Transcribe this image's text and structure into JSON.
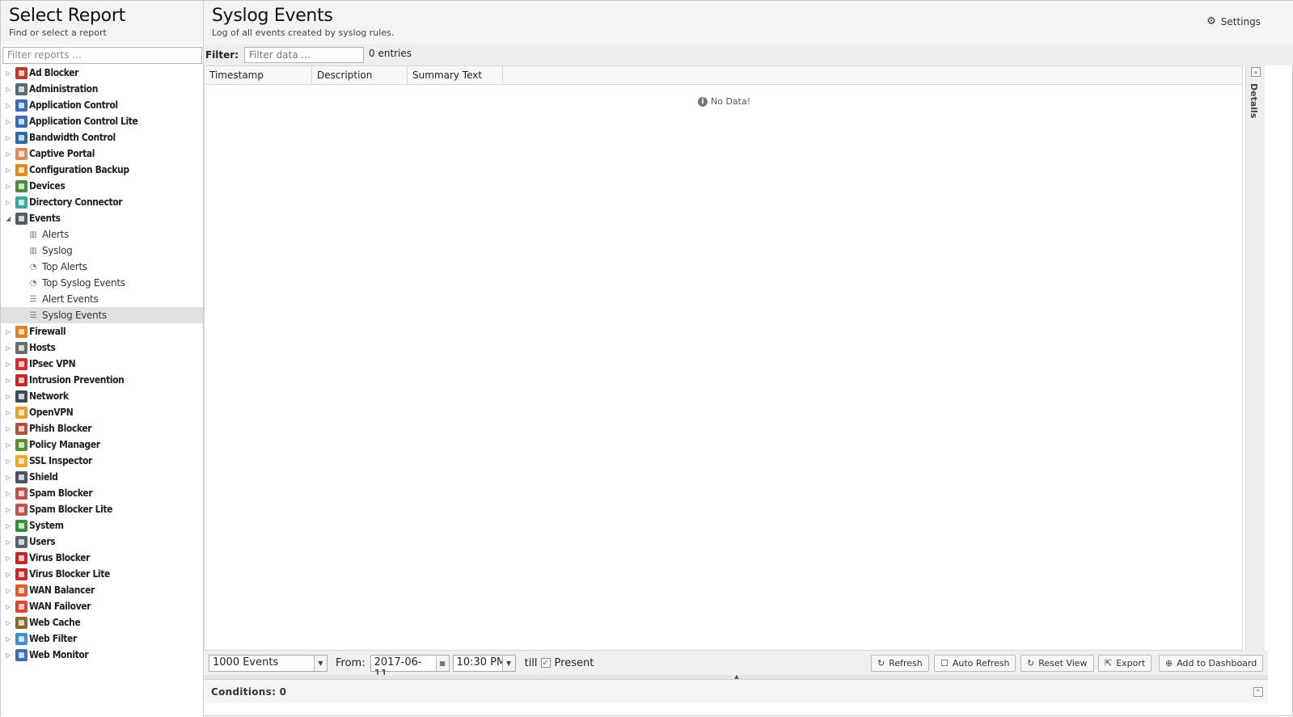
{
  "left": {
    "title": "Select Report",
    "subtitle": "Find or select a report",
    "filter_placeholder": "Filter reports ..."
  },
  "tree": [
    {
      "label": "Ad Blocker",
      "type": "parent",
      "icon": "ad-blocker-icon",
      "color": "#c0392b"
    },
    {
      "label": "Administration",
      "type": "parent",
      "icon": "administration-icon",
      "color": "#5a6b7a"
    },
    {
      "label": "Application Control",
      "type": "parent",
      "icon": "application-control-icon",
      "color": "#3b6db3"
    },
    {
      "label": "Application Control Lite",
      "type": "parent",
      "icon": "application-control-lite-icon",
      "color": "#3b6db3"
    },
    {
      "label": "Bandwidth Control",
      "type": "parent",
      "icon": "bandwidth-control-icon",
      "color": "#2e6da4"
    },
    {
      "label": "Captive Portal",
      "type": "parent",
      "icon": "captive-portal-icon",
      "color": "#d98c5f"
    },
    {
      "label": "Configuration Backup",
      "type": "parent",
      "icon": "configuration-backup-icon",
      "color": "#e08a1e"
    },
    {
      "label": "Devices",
      "type": "parent",
      "icon": "devices-icon",
      "color": "#4b8b3b"
    },
    {
      "label": "Directory Connector",
      "type": "parent",
      "icon": "directory-connector-icon",
      "color": "#3aa89b"
    },
    {
      "label": "Events",
      "type": "parent-open",
      "icon": "events-icon",
      "color": "#555e6a"
    },
    {
      "label": "Alerts",
      "type": "child",
      "icon": "bar-chart-icon",
      "glyph": "▥"
    },
    {
      "label": "Syslog",
      "type": "child",
      "icon": "bar-chart-icon",
      "glyph": "▥"
    },
    {
      "label": "Top Alerts",
      "type": "child",
      "icon": "pie-chart-icon",
      "glyph": "◔"
    },
    {
      "label": "Top Syslog Events",
      "type": "child",
      "icon": "pie-chart-icon",
      "glyph": "◔"
    },
    {
      "label": "Alert Events",
      "type": "child",
      "icon": "list-icon",
      "glyph": "☰"
    },
    {
      "label": "Syslog Events",
      "type": "child-selected",
      "icon": "list-icon",
      "glyph": "☰"
    },
    {
      "label": "Firewall",
      "type": "parent",
      "icon": "firewall-icon",
      "color": "#e67e22"
    },
    {
      "label": "Hosts",
      "type": "parent",
      "icon": "hosts-icon",
      "color": "#6b6b6b"
    },
    {
      "label": "IPsec VPN",
      "type": "parent",
      "icon": "ipsec-vpn-icon",
      "color": "#d32f2f"
    },
    {
      "label": "Intrusion Prevention",
      "type": "parent",
      "icon": "intrusion-prevention-icon",
      "color": "#c62828"
    },
    {
      "label": "Network",
      "type": "parent",
      "icon": "network-icon",
      "color": "#3e4a5a"
    },
    {
      "label": "OpenVPN",
      "type": "parent",
      "icon": "openvpn-icon",
      "color": "#e6a12a"
    },
    {
      "label": "Phish Blocker",
      "type": "parent",
      "icon": "phish-blocker-icon",
      "color": "#b5523b"
    },
    {
      "label": "Policy Manager",
      "type": "parent",
      "icon": "policy-manager-icon",
      "color": "#5a8f2e"
    },
    {
      "label": "SSL Inspector",
      "type": "parent",
      "icon": "ssl-inspector-icon",
      "color": "#f0a71e"
    },
    {
      "label": "Shield",
      "type": "parent",
      "icon": "shield-icon",
      "color": "#4a5563"
    },
    {
      "label": "Spam Blocker",
      "type": "parent",
      "icon": "spam-blocker-icon",
      "color": "#c0504d"
    },
    {
      "label": "Spam Blocker Lite",
      "type": "parent",
      "icon": "spam-blocker-lite-icon",
      "color": "#c0504d"
    },
    {
      "label": "System",
      "type": "parent",
      "icon": "system-icon",
      "color": "#3c8c3c"
    },
    {
      "label": "Users",
      "type": "parent",
      "icon": "users-icon",
      "color": "#5a6470"
    },
    {
      "label": "Virus Blocker",
      "type": "parent",
      "icon": "virus-blocker-icon",
      "color": "#c62828"
    },
    {
      "label": "Virus Blocker Lite",
      "type": "parent",
      "icon": "virus-blocker-lite-icon",
      "color": "#c62828"
    },
    {
      "label": "WAN Balancer",
      "type": "parent",
      "icon": "wan-balancer-icon",
      "color": "#e35a2a"
    },
    {
      "label": "WAN Failover",
      "type": "parent",
      "icon": "wan-failover-icon",
      "color": "#e2462d"
    },
    {
      "label": "Web Cache",
      "type": "parent",
      "icon": "web-cache-icon",
      "color": "#8a6a2a"
    },
    {
      "label": "Web Filter",
      "type": "parent",
      "icon": "web-filter-icon",
      "color": "#3d8fd1"
    },
    {
      "label": "Web Monitor",
      "type": "parent",
      "icon": "web-monitor-icon",
      "color": "#3b6fb6"
    }
  ],
  "main": {
    "title": "Syslog Events",
    "subtitle": "Log of all events created by syslog rules.",
    "settings_label": "Settings",
    "filter_label": "Filter:",
    "filter_placeholder": "Filter data ...",
    "entries": "0 entries",
    "columns": [
      {
        "label": "Timestamp"
      },
      {
        "label": "Description"
      },
      {
        "label": "Summary Text"
      }
    ],
    "no_data": "No Data!",
    "details_label": "Details"
  },
  "toolbar": {
    "limit": "1000 Events",
    "from_label": "From:",
    "from_date": "2017-06-11",
    "from_time": "10:30 PM",
    "till_label": "till",
    "present_label": "Present",
    "present_checked": true,
    "refresh": "Refresh",
    "auto_refresh": "Auto Refresh",
    "reset_view": "Reset View",
    "export": "Export",
    "add_to_dashboard": "Add to Dashboard"
  },
  "conditions": {
    "label": "Conditions: 0"
  }
}
